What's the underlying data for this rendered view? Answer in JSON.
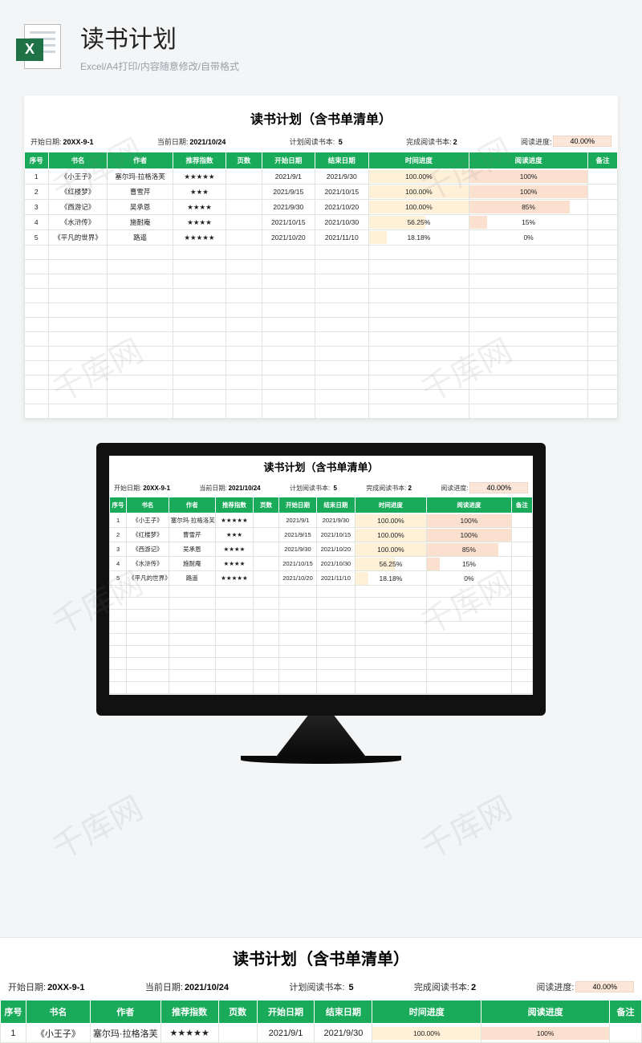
{
  "page_title": "读书计划",
  "subtitle": "Excel/A4打印/内容随意修改/自带格式",
  "excel_badge": "X",
  "watermark_text": "千库网",
  "sheet": {
    "title": "读书计划（含书单清单）",
    "info": {
      "start_label": "开始日期:",
      "start_value": "20XX-9-1",
      "current_label": "当前日期:",
      "current_value": "2021/10/24",
      "plan_label": "计划阅读书本:",
      "plan_value": "5",
      "done_label": "完成阅读书本:",
      "done_value": "2",
      "progress_label": "阅读进度:",
      "progress_value": "40.00%"
    },
    "headers": {
      "seq": "序号",
      "name": "书名",
      "author": "作者",
      "rating": "推荐指数",
      "pages": "页数",
      "start": "开始日期",
      "end": "结束日期",
      "time_progress": "时间进度",
      "read_progress": "阅读进度",
      "note": "备注"
    },
    "rows": [
      {
        "seq": "1",
        "name": "《小王子》",
        "author": "塞尔玛·拉格洛芙",
        "rating": "★★★★★",
        "pages": "",
        "start": "2021/9/1",
        "end": "2021/9/30",
        "time_pct": 100,
        "time_lbl": "100.00%",
        "read_pct": 100,
        "read_lbl": "100%"
      },
      {
        "seq": "2",
        "name": "《红楼梦》",
        "author": "曹雪芹",
        "rating": "★★★",
        "pages": "",
        "start": "2021/9/15",
        "end": "2021/10/15",
        "time_pct": 100,
        "time_lbl": "100.00%",
        "read_pct": 100,
        "read_lbl": "100%"
      },
      {
        "seq": "3",
        "name": "《西游记》",
        "author": "吴承恩",
        "rating": "★★★★",
        "pages": "",
        "start": "2021/9/30",
        "end": "2021/10/20",
        "time_pct": 100,
        "time_lbl": "100.00%",
        "read_pct": 85,
        "read_lbl": "85%"
      },
      {
        "seq": "4",
        "name": "《水浒传》",
        "author": "施耐庵",
        "rating": "★★★★",
        "pages": "",
        "start": "2021/10/15",
        "end": "2021/10/30",
        "time_pct": 56.25,
        "time_lbl": "56.25%",
        "read_pct": 15,
        "read_lbl": "15%"
      },
      {
        "seq": "5",
        "name": "《平凡的世界》",
        "author": "路遥",
        "rating": "★★★★★",
        "pages": "",
        "start": "2021/10/20",
        "end": "2021/11/10",
        "time_pct": 18.18,
        "time_lbl": "18.18%",
        "read_pct": 0,
        "read_lbl": "0%"
      }
    ],
    "empty_rows": 12
  },
  "chart_data": {
    "type": "table",
    "title": "读书计划（含书单清单）",
    "columns": [
      "序号",
      "书名",
      "作者",
      "推荐指数",
      "页数",
      "开始日期",
      "结束日期",
      "时间进度",
      "阅读进度",
      "备注"
    ],
    "rows": [
      [
        "1",
        "《小王子》",
        "塞尔玛·拉格洛芙",
        "★★★★★",
        "",
        "2021/9/1",
        "2021/9/30",
        "100.00%",
        "100%",
        ""
      ],
      [
        "2",
        "《红楼梦》",
        "曹雪芹",
        "★★★",
        "",
        "2021/9/15",
        "2021/10/15",
        "100.00%",
        "100%",
        ""
      ],
      [
        "3",
        "《西游记》",
        "吴承恩",
        "★★★★",
        "",
        "2021/9/30",
        "2021/10/20",
        "100.00%",
        "85%",
        ""
      ],
      [
        "4",
        "《水浒传》",
        "施耐庵",
        "★★★★",
        "",
        "2021/10/15",
        "2021/10/30",
        "56.25%",
        "15%",
        ""
      ],
      [
        "5",
        "《平凡的世界》",
        "路遥",
        "★★★★★",
        "",
        "2021/10/20",
        "2021/11/10",
        "18.18%",
        "0%",
        ""
      ]
    ],
    "summary": {
      "计划阅读书本": 5,
      "完成阅读书本": 2,
      "阅读进度": "40.00%"
    }
  }
}
